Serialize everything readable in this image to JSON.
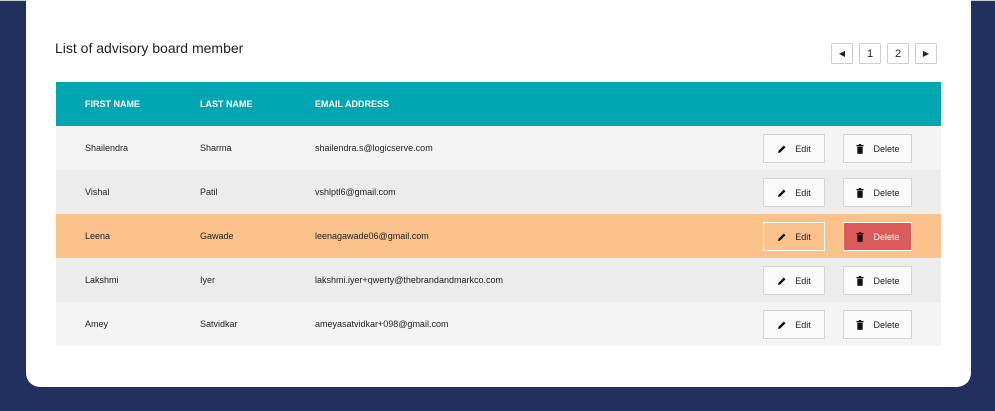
{
  "list_title": "List of advisory board member",
  "pagination": {
    "prev": "◀",
    "pages": [
      "1",
      "2"
    ],
    "next": "▶"
  },
  "table": {
    "headers": [
      "FIRST NAME",
      "LAST NAME",
      "EMAIL ADDRESS"
    ],
    "rows": [
      {
        "first": "Shailendra",
        "last": "Sharma",
        "email": "shailendra.s@logicserve.com"
      },
      {
        "first": "Vishal",
        "last": "Patil",
        "email": "vshlptl6@gmail.com"
      },
      {
        "first": "Leena",
        "last": "Gawade",
        "email": "leenagawade06@gmail.com"
      },
      {
        "first": "Lakshmi",
        "last": "Iyer",
        "email": "lakshmi.iyer+qwerty@thebrandandmarkco.com"
      },
      {
        "first": "Amey",
        "last": "Satvidkar",
        "email": "ameyasatvidkar+098@gmail.com"
      }
    ],
    "edit_label": "Edit",
    "delete_label": "Delete"
  },
  "icons": {
    "edit": "pencil-icon",
    "delete": "trash-icon"
  },
  "colors": {
    "background": "#21305f",
    "header": "#00a6b2",
    "highlight_row": "#fbc28c",
    "delete_active": "#dd5a5a"
  }
}
